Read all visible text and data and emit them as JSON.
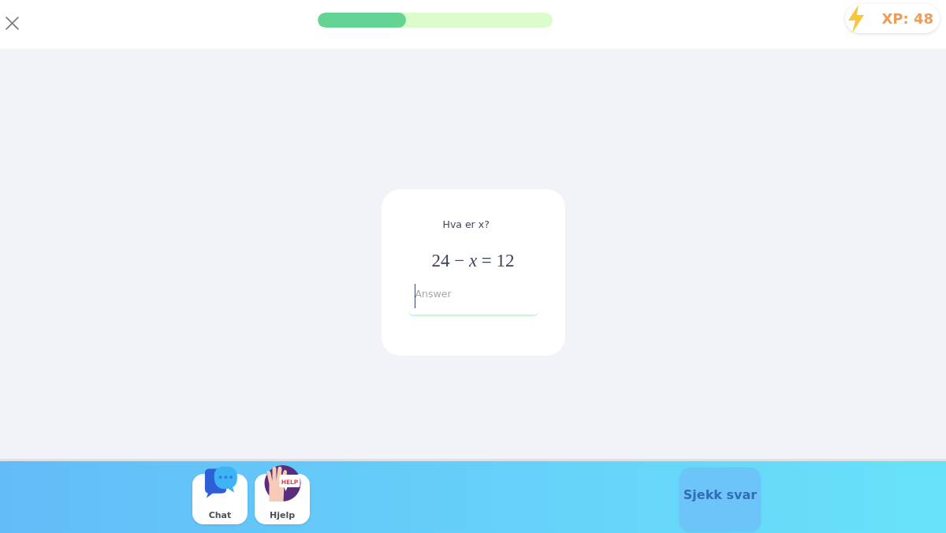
{
  "header": {
    "progress": {
      "level": 0.375
    },
    "xp": {
      "label": "XP: 48"
    }
  },
  "question": {
    "prompt": "Hva er x?",
    "equation": "24 − *x* = 12",
    "answer": {
      "placeholder": "Answer",
      "focused": true
    }
  },
  "tools": [
    {
      "kind": "chat",
      "label": "Chat"
    },
    {
      "kind": "help",
      "label": "Hjelp",
      "sign": "HELP"
    }
  ],
  "submit": {
    "label": "Sjekk svar",
    "disabled": true
  }
}
